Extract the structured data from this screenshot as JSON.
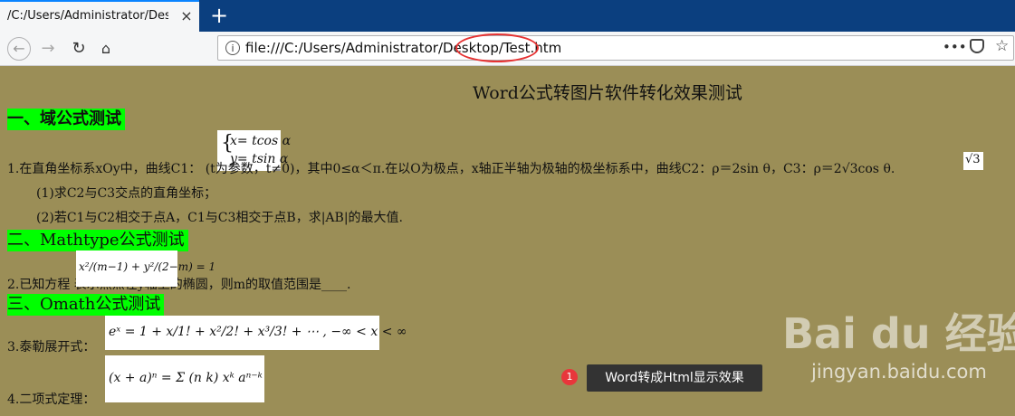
{
  "browser": {
    "tab_title": "/C:/Users/Administrator/Desktop/Test.htm",
    "tab_close": "×",
    "new_tab": "+",
    "url": "file:///C:/Users/Administrator/Desktop/Test.htm",
    "info": "i",
    "more": "•••"
  },
  "doc": {
    "title": "Word公式转图片软件转化效果测试",
    "sections": [
      "一、域公式测试",
      "二、Mathtype公式测试",
      "三、Omath公式测试"
    ],
    "q1": "1.在直角坐标系xOy中，曲线C1：                  (t为参数，t≠0)，其中0≤α＜π.在以O为极点，x轴正半轴为极轴的极坐标系中，曲线C2：ρ＝2sin θ，C3：ρ＝2√3cos θ.",
    "q1a": "(1)求C2与C3交点的直角坐标；",
    "q1b": "(2)若C1与C2相交于点A，C1与C3相交于点B，求|AB|的最大值.",
    "q2": "2.已知方程                              表示焦点在y轴上的椭圆，则m的取值范围是____.",
    "q3": "3.泰勒展开式：",
    "q4": "4.二项式定理："
  },
  "math": {
    "param_x": "x= tcos α",
    "param_y": "y= tsin α",
    "sqrt3": "√3",
    "ellipse": "x²/(m−1) + y²/(2−m) = 1",
    "taylor": "eˣ = 1 + x/1! + x²/2! + x³/3! + ⋯ ,      −∞ < x < ∞",
    "binom": "(x + a)ⁿ = Σ (n k) xᵏ aⁿ⁻ᵏ"
  },
  "watermark": {
    "badge": "1",
    "caption": "Word转成Html显示效果",
    "logo": "Bai du 经验",
    "url": "jingyan.baidu.com"
  }
}
